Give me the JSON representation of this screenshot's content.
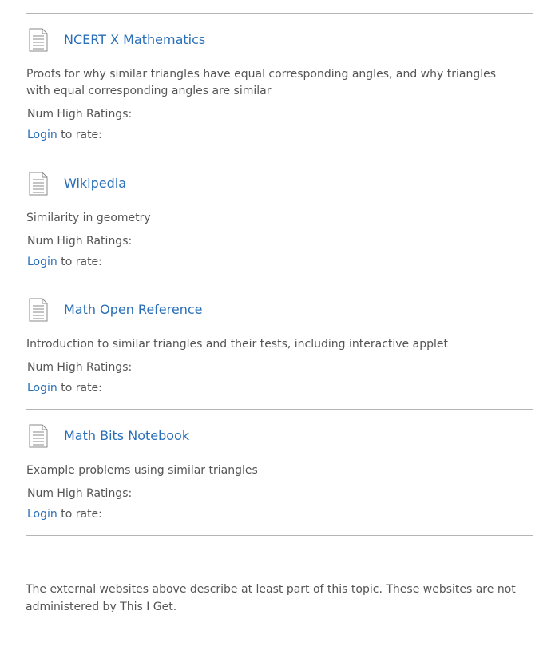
{
  "colors": {
    "link": "#2a6fb8",
    "text": "#555555",
    "divider": "#b5b5b5",
    "icon_stroke": "#8a8a8a"
  },
  "resources": [
    {
      "icon": "document-icon",
      "title": "NCERT X Mathematics",
      "description": "Proofs for why similar triangles have equal corresponding angles, and why triangles with equal corresponding angles are similar",
      "ratings_label": "Num High Ratings:",
      "login_label": "Login",
      "rate_suffix": " to rate:"
    },
    {
      "icon": "document-icon",
      "title": "Wikipedia",
      "description": "Similarity in geometry",
      "ratings_label": "Num High Ratings:",
      "login_label": "Login",
      "rate_suffix": " to rate:"
    },
    {
      "icon": "document-icon",
      "title": "Math Open Reference",
      "description": "Introduction to similar triangles and their tests, including interactive applet",
      "ratings_label": "Num High Ratings:",
      "login_label": "Login",
      "rate_suffix": " to rate:"
    },
    {
      "icon": "document-icon",
      "title": "Math Bits Notebook",
      "description": "Example problems using similar triangles",
      "ratings_label": "Num High Ratings:",
      "login_label": "Login",
      "rate_suffix": " to rate:"
    }
  ],
  "footer": {
    "note": "The external websites above describe at least part of this topic. These websites are not administered by This I Get."
  }
}
